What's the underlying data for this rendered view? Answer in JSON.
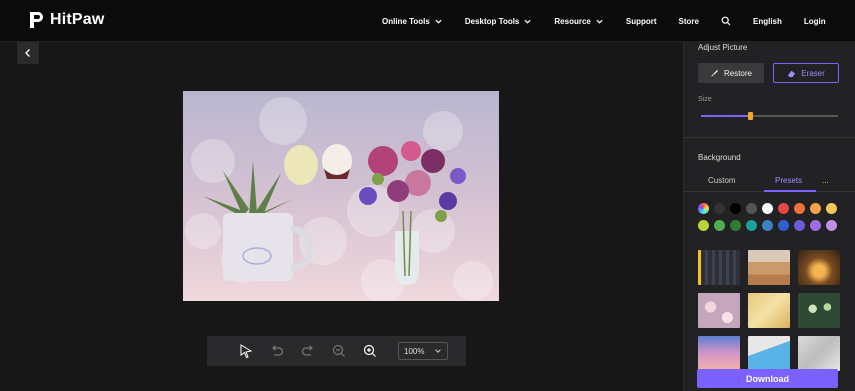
{
  "brand": {
    "name": "HitPaw"
  },
  "nav": {
    "online_tools": "Online Tools",
    "desktop_tools": "Desktop Tools",
    "resource": "Resource",
    "support": "Support",
    "store": "Store",
    "language": "English",
    "login": "Login"
  },
  "toolbar": {
    "zoom": "100%"
  },
  "panel": {
    "adjust_title": "Adjust Picture",
    "restore_label": "Restore",
    "eraser_label": "Eraser",
    "size_label": "Size",
    "size_level": 0.36,
    "background_title": "Background",
    "tab_custom": "Custom",
    "tab_presets": "Presets",
    "tab_more": "...",
    "colors_row1": [
      "#ff6b6b",
      "#333333",
      "#000000",
      "#555555",
      "#ffffff",
      "#e84545",
      "#f2703a",
      "#f5a14a",
      "#f5c65a"
    ],
    "colors_row2": [
      "#b7d43a",
      "#4caf50",
      "#2e7d32",
      "#1aa39a",
      "#3b82c4",
      "#2f5fd0",
      "#6b5bd6",
      "#9c6fe0",
      "#c28fe8"
    ]
  },
  "download_label": "Download",
  "accent": "#7b61ff"
}
